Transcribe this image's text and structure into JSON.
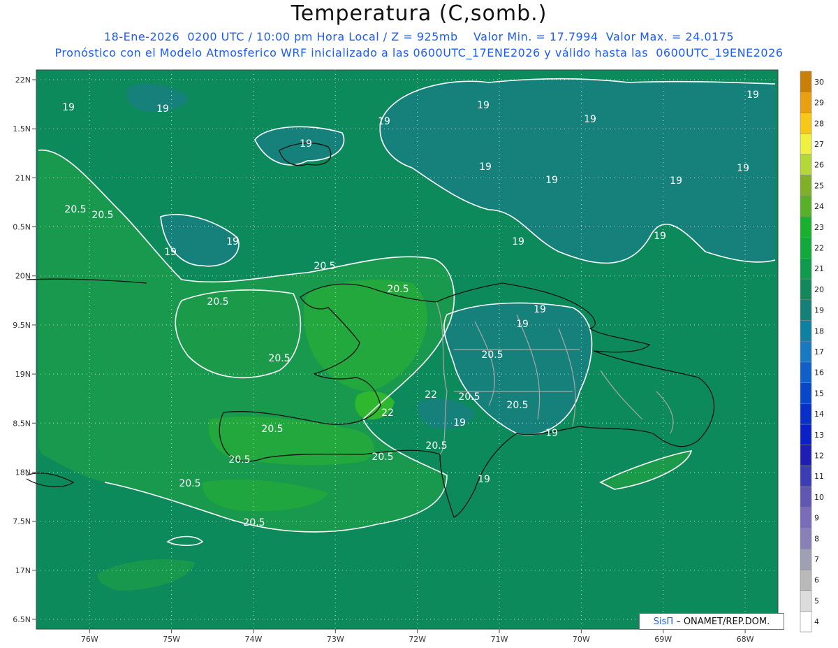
{
  "title": "Temperatura (C,somb.)",
  "subtitle_1": "18-Ene-2026  0200 UTC / 10:00 pm Hora Local / Z = 925mb    Valor Min. = 17.7994  Valor Max. = 24.0175",
  "subtitle_2": "Pronóstico con el Modelo Atmosferico WRF inicializado a las 0600UTC_17ENE2026 y válido hasta las  0600UTC_19ENE2026",
  "brand": {
    "sis": "SisΠ",
    "text": "– ONAMET/REP.DOM."
  },
  "chart_data": {
    "type": "heatmap",
    "variable": "Temperatura 925mb (C)",
    "x_ticks": [
      "76W",
      "75W",
      "74W",
      "73W",
      "72W",
      "71W",
      "70W",
      "69W",
      "68W"
    ],
    "x_values": [
      -76,
      -75,
      -74,
      -73,
      -72,
      -71,
      -70,
      -69,
      -68
    ],
    "y_ticks": [
      "22N",
      "1.5N",
      "21N",
      "0.5N",
      "20N",
      "9.5N",
      "19N",
      "8.5N",
      "18N",
      "7.5N",
      "17N",
      "6.5N"
    ],
    "y_values": [
      22,
      21.5,
      21,
      20.5,
      20,
      19.5,
      19,
      18.5,
      18,
      17.5,
      17,
      16.5
    ],
    "xlim": [
      -76.65,
      -67.6
    ],
    "ylim": [
      16.4,
      22.1
    ],
    "grid": true,
    "min_value": 17.7994,
    "max_value": 24.0175,
    "contour_labels": [
      "19",
      "20.5",
      "22"
    ],
    "colorbar": {
      "labels": [
        "4",
        "5",
        "6",
        "7",
        "8",
        "9",
        "10",
        "11",
        "12",
        "13",
        "14",
        "15",
        "16",
        "17",
        "18",
        "19",
        "20",
        "21",
        "22",
        "23",
        "24",
        "25",
        "26",
        "27",
        "28",
        "29",
        "30"
      ],
      "colors": [
        "#ffffff",
        "#dcdcdc",
        "#b9b9b9",
        "#a0a0b4",
        "#8a80b8",
        "#7a6cb8",
        "#6058b0",
        "#3c3cb4",
        "#1e1eb4",
        "#0c20c8",
        "#0830c8",
        "#0848c8",
        "#1060c8",
        "#1878c0",
        "#1080a0",
        "#148078",
        "#12885c",
        "#109a4c",
        "#12a83c",
        "#18b02c",
        "#58b028",
        "#80b028",
        "#b4d838",
        "#f0f040",
        "#f8c818",
        "#e8a010",
        "#c88008"
      ]
    },
    "field_levels": {
      "background_le_20": "#0d8a5c",
      "teal_lt_19": "#16817a",
      "green_20_5_21": "#1b9b4a",
      "green_21_22": "#22a83d",
      "bright_22": "#2fb730"
    }
  }
}
